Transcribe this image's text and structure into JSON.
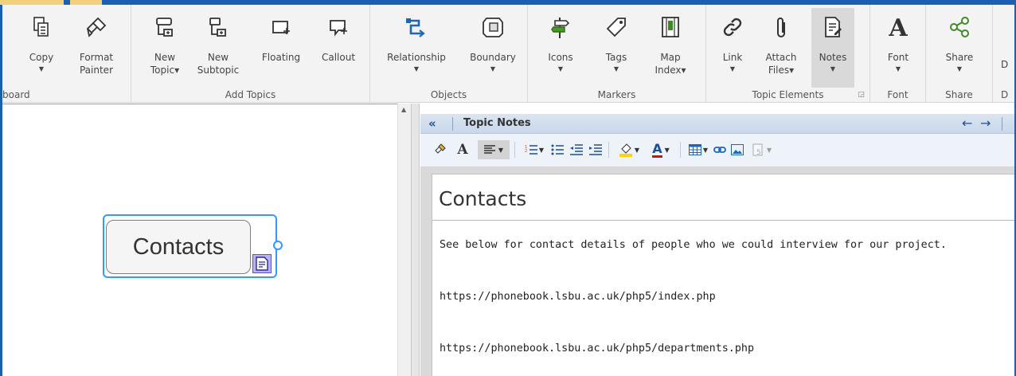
{
  "ribbon": {
    "groups": [
      {
        "label": "board",
        "buttons": [
          {
            "label": "Copy",
            "dropdown": true
          },
          {
            "label": "Format\nPainter",
            "dropdown": false
          }
        ]
      },
      {
        "label": "Add Topics",
        "buttons": [
          {
            "label": "New\nTopic▾"
          },
          {
            "label": "New\nSubtopic"
          },
          {
            "label": "Floating"
          },
          {
            "label": "Callout"
          }
        ]
      },
      {
        "label": "Objects",
        "buttons": [
          {
            "label": "Relationship",
            "dropdown": true
          },
          {
            "label": "Boundary",
            "dropdown": true
          }
        ]
      },
      {
        "label": "Markers",
        "buttons": [
          {
            "label": "Icons",
            "dropdown": true
          },
          {
            "label": "Tags",
            "dropdown": true
          },
          {
            "label": "Map\nIndex▾"
          }
        ]
      },
      {
        "label": "Topic Elements",
        "buttons": [
          {
            "label": "Link",
            "dropdown": true
          },
          {
            "label": "Attach\nFiles▾"
          },
          {
            "label": "Notes",
            "dropdown": true,
            "active": true
          }
        ]
      },
      {
        "label": "Font",
        "buttons": [
          {
            "label": "Font",
            "dropdown": true
          }
        ]
      },
      {
        "label": "Share",
        "buttons": [
          {
            "label": "Share",
            "dropdown": true
          }
        ]
      }
    ],
    "partial_label": "D",
    "partial_group_label": "D"
  },
  "map": {
    "topic_title": "Contacts"
  },
  "notes": {
    "header_title": "Topic Notes",
    "heading": "Contacts",
    "lines": [
      "See below for contact details of people who we could interview for our project.",
      "https://phonebook.lsbu.ac.uk/php5/index.php",
      "https://phonebook.lsbu.ac.uk/php5/departments.php"
    ]
  },
  "colors": {
    "accent": "#1a5fb4",
    "selection": "#3399ff",
    "header_bg": "#dbe5f1"
  }
}
